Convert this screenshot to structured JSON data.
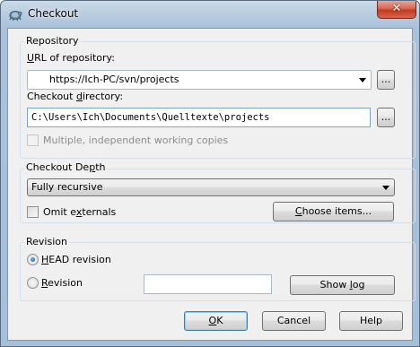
{
  "window": {
    "title": "Checkout",
    "close_glyph": "✕",
    "app_icon": "tortoise-svn-icon"
  },
  "repository": {
    "group_label": "Repository",
    "url_label_ul": "U",
    "url_label_rest": "RL of repository:",
    "url_value": "https://Ich-PC/svn/projects",
    "browse_label": "...",
    "dir_label_pre": "Checkout ",
    "dir_label_ul": "d",
    "dir_label_post": "irectory:",
    "dir_value": "C:\\Users\\Ich\\Documents\\Quelltexte\\projects",
    "dir_browse_label": "...",
    "multiple_label": "Multiple, independent working copies",
    "multiple_checked": false
  },
  "depth": {
    "group_label_pre": "Checkout De",
    "group_label_ul": "p",
    "group_label_post": "th",
    "selected": "Fully recursive",
    "omit_pre": "Omit e",
    "omit_ul": "x",
    "omit_post": "ternals",
    "omit_checked": false,
    "choose_pre": "",
    "choose_ul": "C",
    "choose_post": "hoose items..."
  },
  "revision": {
    "group_label": "Revision",
    "head_ul": "H",
    "head_post": "EAD revision",
    "head_selected": true,
    "rev_pre": "",
    "rev_ul": "R",
    "rev_post": "evision",
    "rev_selected": false,
    "rev_value": "",
    "show_log_pre": "Show ",
    "show_log_ul": "l",
    "show_log_post": "og"
  },
  "buttons": {
    "ok_ul": "O",
    "ok_post": "K",
    "cancel": "Cancel",
    "help": "Help"
  }
}
